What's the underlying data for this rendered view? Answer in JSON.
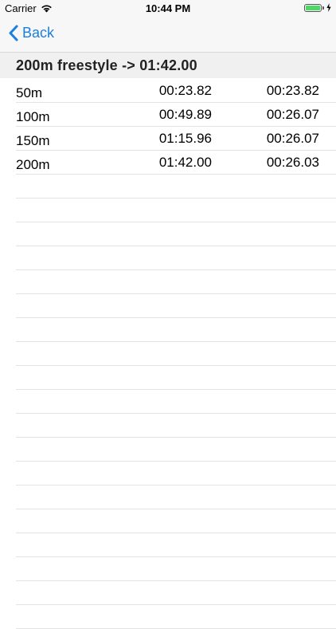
{
  "status_bar": {
    "carrier": "Carrier",
    "time": "10:44 PM"
  },
  "nav": {
    "back_label": "Back",
    "accent_color": "#1a7fe0"
  },
  "section": {
    "title": "200m freestyle -> 01:42.00"
  },
  "splits": [
    {
      "distance": "50m",
      "total": "00:23.82",
      "split": "00:23.82"
    },
    {
      "distance": "100m",
      "total": "00:49.89",
      "split": "00:26.07"
    },
    {
      "distance": "150m",
      "total": "01:15.96",
      "split": "00:26.07"
    },
    {
      "distance": "200m",
      "total": "01:42.00",
      "split": "00:26.03"
    }
  ]
}
